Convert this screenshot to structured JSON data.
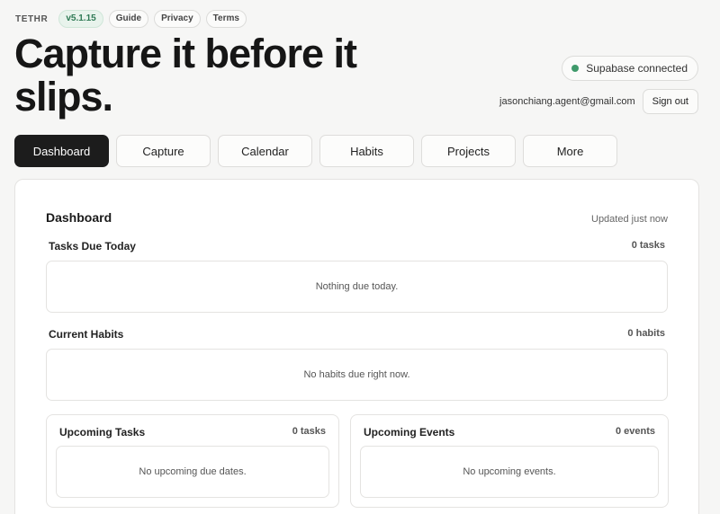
{
  "topbar": {
    "brand": "TETHR",
    "version": "v5.1.15",
    "links": [
      "Guide",
      "Privacy",
      "Terms"
    ]
  },
  "hero": {
    "title": "Capture it before it slips."
  },
  "connection": {
    "status": "Supabase connected",
    "status_color": "#3f9a6b"
  },
  "auth": {
    "email": "jasonchiang.agent@gmail.com",
    "sign_out_label": "Sign out"
  },
  "tabs": [
    {
      "label": "Dashboard",
      "active": true
    },
    {
      "label": "Capture",
      "active": false
    },
    {
      "label": "Calendar",
      "active": false
    },
    {
      "label": "Habits",
      "active": false
    },
    {
      "label": "Projects",
      "active": false
    },
    {
      "label": "More",
      "active": false
    }
  ],
  "dashboard": {
    "title": "Dashboard",
    "updated": "Updated just now",
    "tasks_due_today": {
      "title": "Tasks Due Today",
      "count": "0 tasks",
      "empty": "Nothing due today."
    },
    "current_habits": {
      "title": "Current Habits",
      "count": "0 habits",
      "empty": "No habits due right now."
    },
    "upcoming_tasks": {
      "title": "Upcoming Tasks",
      "count": "0 tasks",
      "empty": "No upcoming due dates."
    },
    "upcoming_events": {
      "title": "Upcoming Events",
      "count": "0 events",
      "empty": "No upcoming events."
    }
  },
  "colors": {
    "accent_dark": "#1c1c1c",
    "version_green": "#2f7a55",
    "background": "#f6f6f5"
  }
}
